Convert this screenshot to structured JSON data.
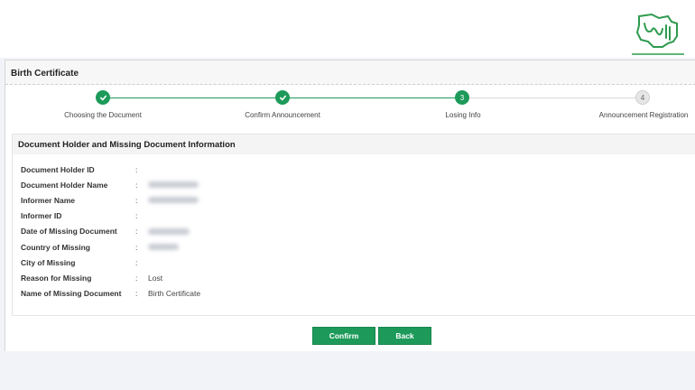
{
  "panel": {
    "title": "Birth Certificate"
  },
  "steps": [
    {
      "label": "Choosing the Document",
      "number": "1",
      "state": "done"
    },
    {
      "label": "Confirm Announcement",
      "number": "2",
      "state": "done"
    },
    {
      "label": "Losing Info",
      "number": "3",
      "state": "current"
    },
    {
      "label": "Announcement Registration",
      "number": "4",
      "state": "todo"
    }
  ],
  "section": {
    "title": "Document Holder and Missing Document Information",
    "colon": ":",
    "rows": [
      {
        "label": "Document Holder ID",
        "value": ""
      },
      {
        "label": "Document Holder Name",
        "value": ""
      },
      {
        "label": "Informer Name",
        "value": ""
      },
      {
        "label": "Informer ID",
        "value": ""
      },
      {
        "label": "Date of Missing Document",
        "value": ""
      },
      {
        "label": "Country of Missing",
        "value": ""
      },
      {
        "label": "City of Missing",
        "value": ""
      },
      {
        "label": "Reason for Missing",
        "value": "Lost"
      },
      {
        "label": "Name of Missing Document",
        "value": "Birth Certificate"
      }
    ]
  },
  "buttons": {
    "confirm": "Confirm",
    "back": "Back"
  },
  "colors": {
    "accent": "#1d9a5a",
    "logo": "#2e9a4e"
  },
  "icons": {
    "done": "check-icon",
    "logo": "site-logo-icon"
  }
}
